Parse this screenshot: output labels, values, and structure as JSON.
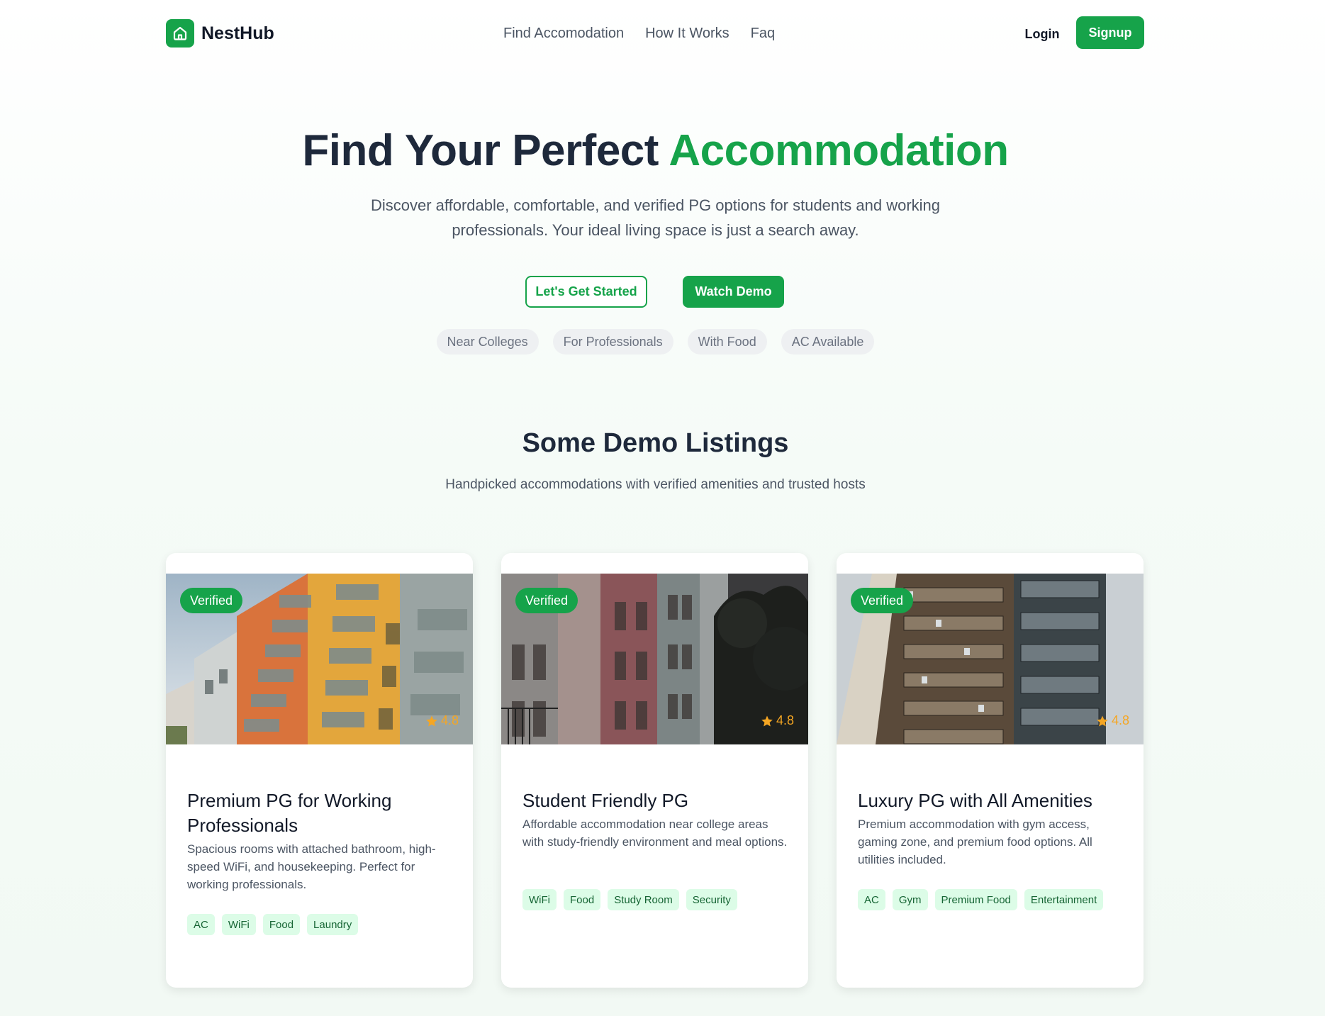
{
  "brand": {
    "name": "NestHub",
    "color": "#16a34a",
    "icon": "house-icon"
  },
  "nav": {
    "items": [
      "Find Accomodation",
      "How It Works",
      "Faq"
    ],
    "login_label": "Login",
    "signup_label": "Signup"
  },
  "hero": {
    "title_main": "Find Your Perfect ",
    "title_accent": "Accommodation",
    "subtitle": "Discover affordable, comfortable, and verified PG options for students and working professionals. Your ideal living space is just a search away.",
    "primary_cta": "Let's Get Started",
    "secondary_cta": "Watch Demo",
    "filters": [
      "Near Colleges",
      "For Professionals",
      "With Food",
      "AC Available"
    ]
  },
  "listings_section": {
    "title": "Some Demo Listings",
    "subtitle": "Handpicked accommodations with verified amenities and trusted hosts"
  },
  "listings": [
    {
      "badge": "Verified",
      "rating": "4.8",
      "title": "Premium PG for Working Professionals",
      "description": "Spacious rooms with attached bathroom, high-speed WiFi, and housekeeping. Perfect for working professionals.",
      "amenities": [
        "AC",
        "WiFi",
        "Food",
        "Laundry"
      ],
      "image": "colorful-apartment-balconies-photo"
    },
    {
      "badge": "Verified",
      "rating": "4.8",
      "title": "Student Friendly PG",
      "description": "Affordable accommodation near college areas with study-friendly environment and meal options.",
      "amenities": [
        "WiFi",
        "Food",
        "Study Room",
        "Security"
      ],
      "image": "old-street-buildings-photo"
    },
    {
      "badge": "Verified",
      "rating": "4.8",
      "title": "Luxury PG with All Amenities",
      "description": "Premium accommodation with gym access, gaming zone, and premium food options. All utilities included.",
      "amenities": [
        "AC",
        "Gym",
        "Premium Food",
        "Entertainment"
      ],
      "image": "tall-apartment-tower-photo"
    }
  ],
  "colors": {
    "accent": "#16a34a",
    "star": "#f5a623",
    "tag_bg": "#dcfce7",
    "tag_text": "#166534"
  }
}
